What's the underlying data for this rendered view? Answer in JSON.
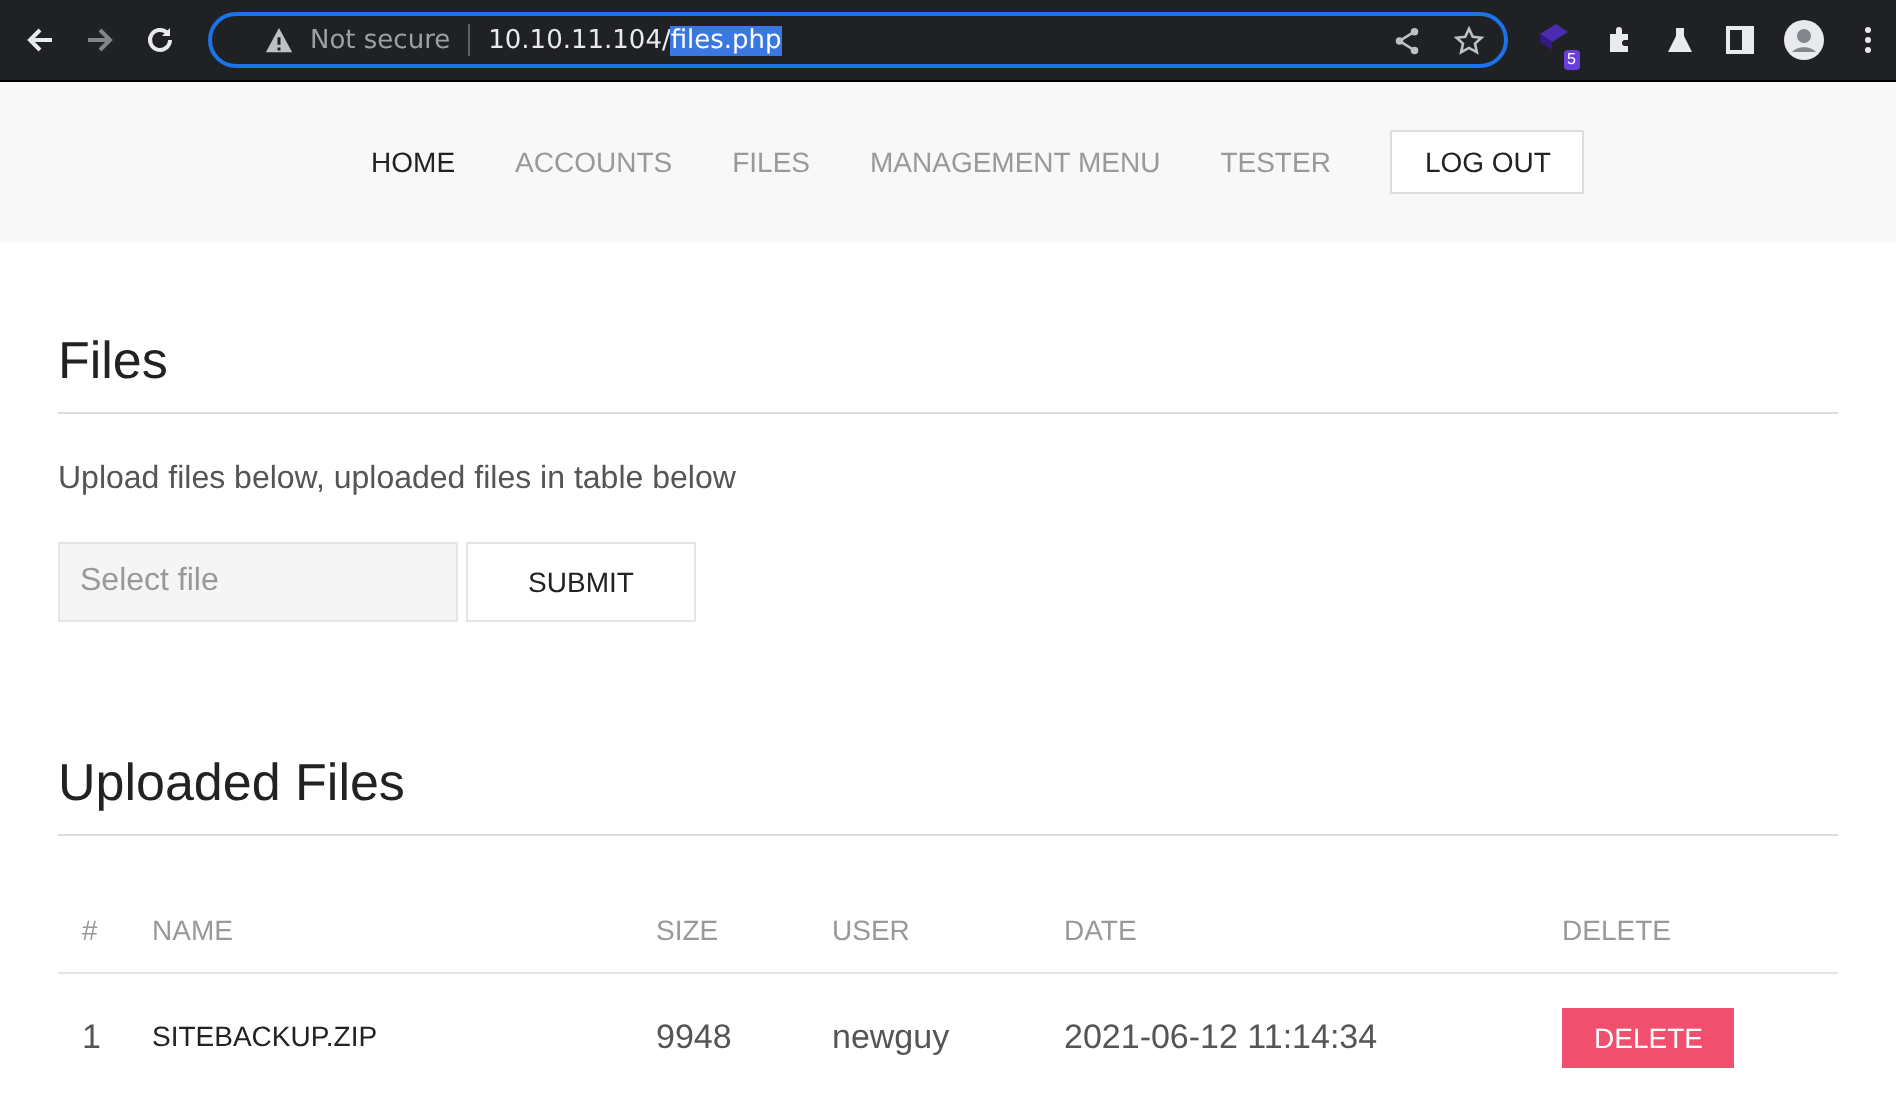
{
  "browser": {
    "security": "Not secure",
    "url_host": "10.10.11.104/",
    "url_path": "files.php",
    "extension_badge": "5"
  },
  "nav": {
    "items": [
      {
        "label": "HOME",
        "selected": true
      },
      {
        "label": "ACCOUNTS",
        "selected": false
      },
      {
        "label": "FILES",
        "selected": false
      },
      {
        "label": "MANAGEMENT MENU",
        "selected": false
      },
      {
        "label": "TESTER",
        "selected": false
      }
    ],
    "logout": "LOG OUT"
  },
  "files_section": {
    "title": "Files",
    "description": "Upload files below, uploaded files in table below",
    "file_field": {
      "placeholder": "Select file"
    },
    "submit": "SUBMIT"
  },
  "uploaded_section": {
    "title": "Uploaded Files",
    "table": {
      "columns": [
        "#",
        "NAME",
        "SIZE",
        "USER",
        "DATE",
        "DELETE"
      ],
      "rows": [
        {
          "index": "1",
          "name": "SITEBACKUP.ZIP",
          "size": "9948",
          "user": "newguy",
          "date": "2021-06-12 11:14:34",
          "action": "DELETE"
        }
      ]
    }
  }
}
